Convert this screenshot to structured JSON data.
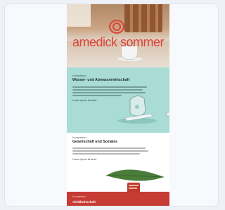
{
  "logo": {
    "text": "amedick sommer"
  },
  "sections": [
    {
      "kicker": "Kompetenz",
      "heading": "Wasser- und Abwasserwirtschaft",
      "link": "Lorem ipsum sit amet"
    },
    {
      "kicker": "Kompetenz",
      "heading": "Gesellschaft und Soziales",
      "link": "Lorem ipsum sit amet"
    },
    {
      "kicker": "Kompetenz",
      "heading": "Abfallwirtschaft"
    }
  ],
  "colors": {
    "brand_red": "#d9453c",
    "teal": "#a8dcd5",
    "footer_red": "#c63b34"
  },
  "icons": [
    "logo-ring-icon",
    "faucet-illustration",
    "leaf-illustration",
    "scroll-to-top-icon"
  ]
}
